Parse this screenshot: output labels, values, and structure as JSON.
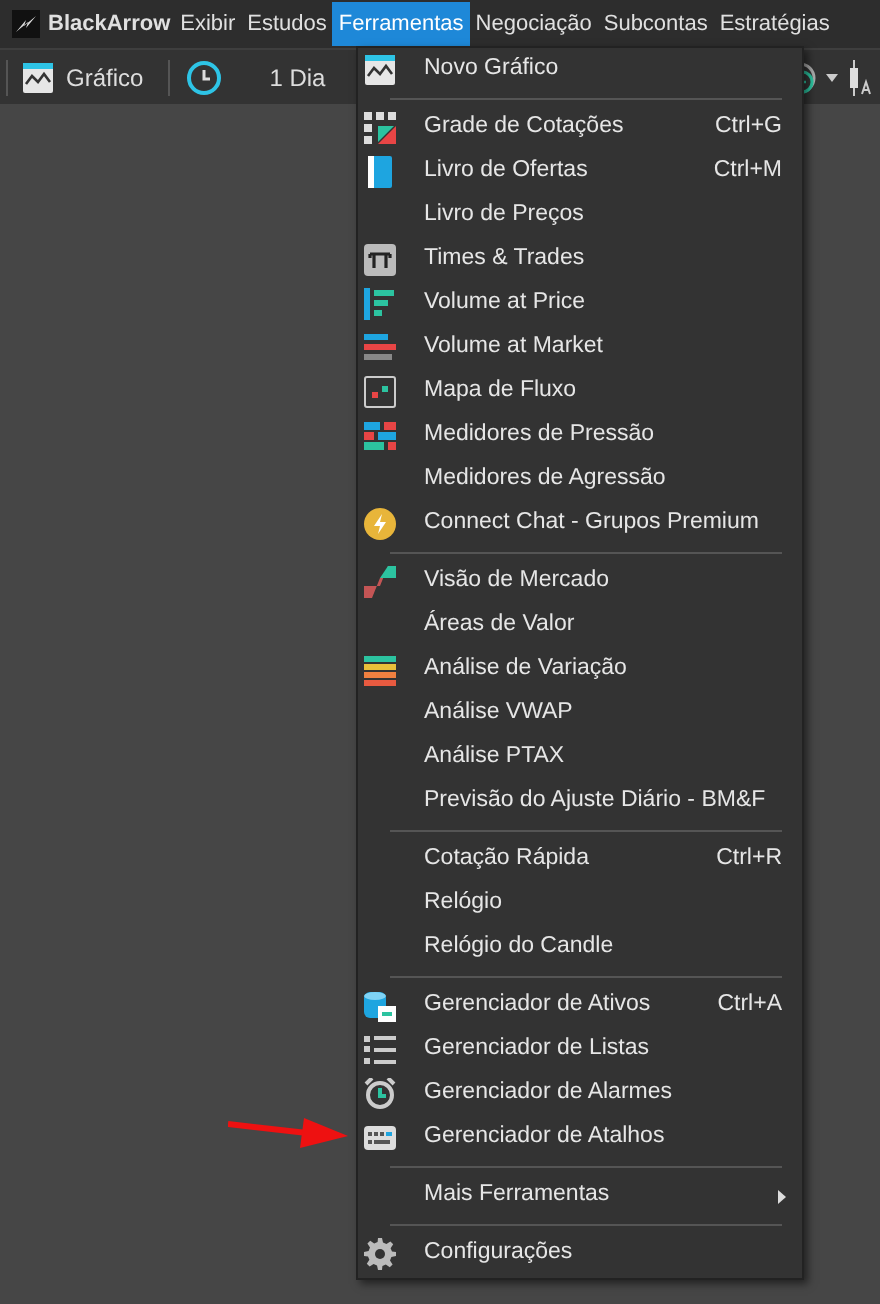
{
  "menubar": {
    "logo": "BlackArrow",
    "items": [
      {
        "label": "Exibir",
        "selected": false
      },
      {
        "label": "Estudos",
        "selected": false
      },
      {
        "label": "Ferramentas",
        "selected": true
      },
      {
        "label": "Negociação",
        "selected": false
      },
      {
        "label": "Subcontas",
        "selected": false
      },
      {
        "label": "Estratégias",
        "selected": false
      }
    ]
  },
  "toolbar": {
    "chart_button": "Gráfico",
    "period": "1 Dia"
  },
  "menu": {
    "items": [
      {
        "kind": "item",
        "label": "Novo Gráfico"
      },
      {
        "kind": "separator"
      },
      {
        "kind": "item",
        "label": "Grade de Cotações",
        "shortcut": "Ctrl+G"
      },
      {
        "kind": "item",
        "label": "Livro de Ofertas",
        "shortcut": "Ctrl+M"
      },
      {
        "kind": "item",
        "label": "Livro de Preços"
      },
      {
        "kind": "item",
        "label": "Times & Trades"
      },
      {
        "kind": "item",
        "label": "Volume at Price"
      },
      {
        "kind": "item",
        "label": "Volume at Market"
      },
      {
        "kind": "item",
        "label": "Mapa de Fluxo"
      },
      {
        "kind": "item",
        "label": "Medidores de Pressão"
      },
      {
        "kind": "item",
        "label": "Medidores de Agressão"
      },
      {
        "kind": "item",
        "label": "Connect Chat - Grupos Premium"
      },
      {
        "kind": "separator"
      },
      {
        "kind": "item",
        "label": "Visão de Mercado"
      },
      {
        "kind": "item",
        "label": "Áreas de Valor"
      },
      {
        "kind": "item",
        "label": "Análise de Variação"
      },
      {
        "kind": "item",
        "label": "Análise VWAP"
      },
      {
        "kind": "item",
        "label": "Análise PTAX"
      },
      {
        "kind": "item",
        "label": "Previsão do Ajuste Diário - BM&F"
      },
      {
        "kind": "separator"
      },
      {
        "kind": "item",
        "label": "Cotação Rápida",
        "shortcut": "Ctrl+R"
      },
      {
        "kind": "item",
        "label": "Relógio"
      },
      {
        "kind": "item",
        "label": "Relógio do Candle"
      },
      {
        "kind": "separator"
      },
      {
        "kind": "item",
        "label": "Gerenciador de Ativos",
        "shortcut": "Ctrl+A"
      },
      {
        "kind": "item",
        "label": "Gerenciador de Listas"
      },
      {
        "kind": "item",
        "label": "Gerenciador de Alarmes"
      },
      {
        "kind": "item",
        "label": "Gerenciador de Atalhos"
      },
      {
        "kind": "separator"
      },
      {
        "kind": "submenu",
        "label": "Mais Ferramentas"
      },
      {
        "kind": "separator"
      },
      {
        "kind": "item",
        "label": "Configurações"
      }
    ]
  }
}
